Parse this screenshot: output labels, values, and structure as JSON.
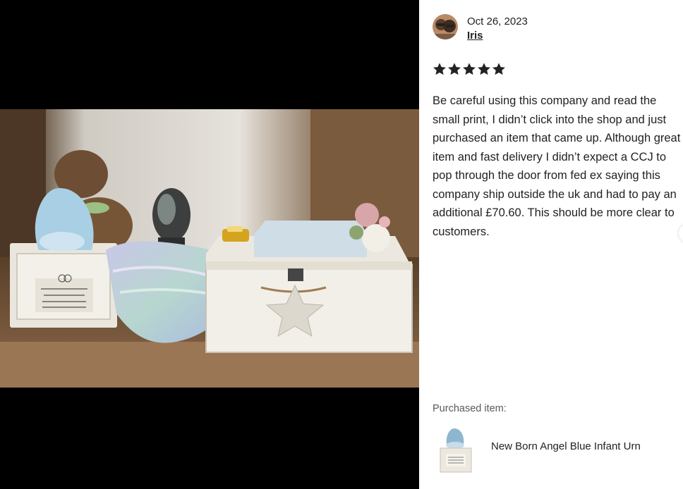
{
  "review": {
    "date": "Oct 26, 2023",
    "author": "Iris",
    "rating": 5,
    "max_rating": 5,
    "star_color": "#222222",
    "text": "Be careful using this company and read the small print, I didn’t click into the shop and just purchased an item that came up. Although great item and fast delivery I didn’t expect a CCJ to pop through the door from fed ex saying this company ship outside the uk and had to pay an additional £70.60. This should be more clear to customers."
  },
  "purchase": {
    "label": "Purchased item:",
    "item_name": "New Born Angel Blue Infant Urn"
  },
  "icons": {
    "star": "star-icon",
    "avatar": "user-avatar"
  }
}
